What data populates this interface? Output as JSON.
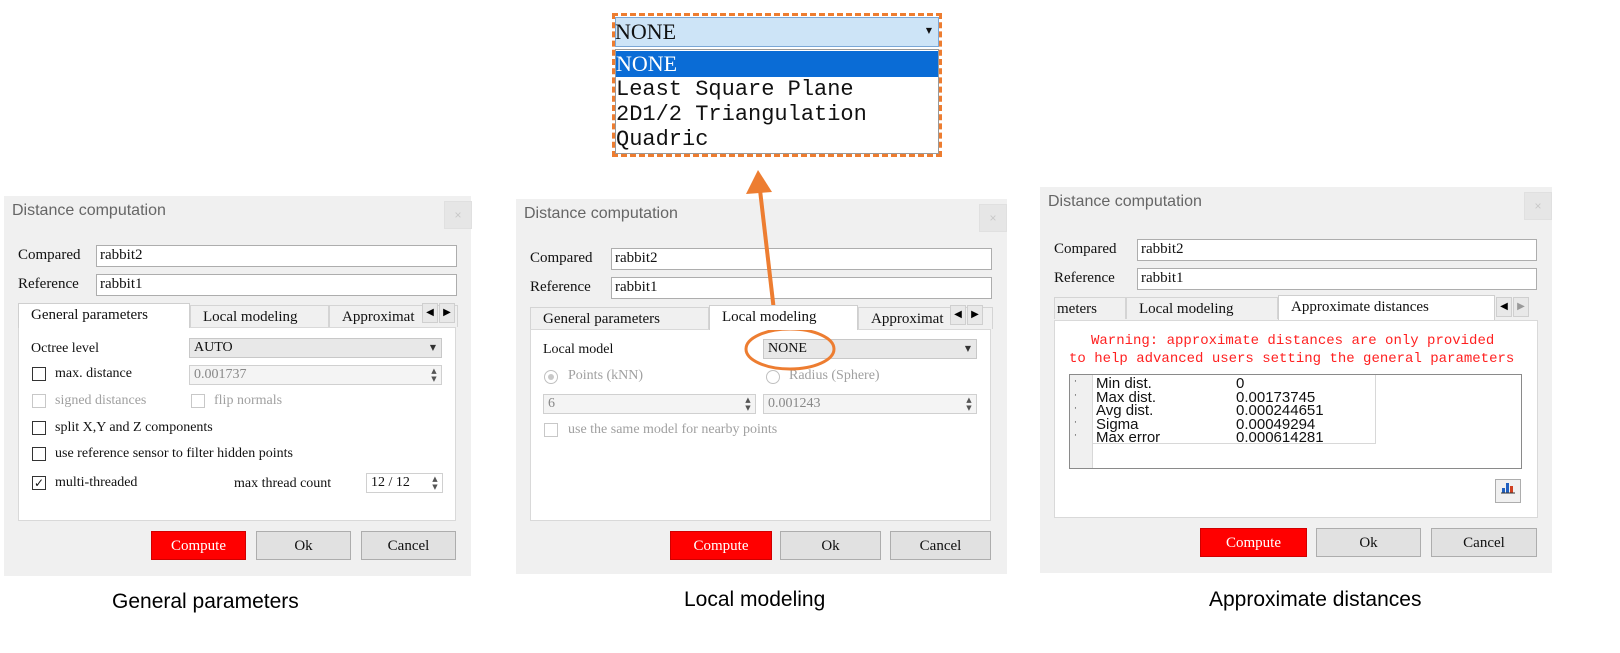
{
  "dialog_title": "Distance computation",
  "close_label": "×",
  "compared_label": "Compared",
  "compared_value": "rabbit2",
  "reference_label": "Reference",
  "reference_value": "rabbit1",
  "tabs": {
    "general": "General parameters",
    "local": "Local modeling",
    "approx_short": "Approximat",
    "approx_full": "Approximate distances",
    "params_cut": "meters"
  },
  "general": {
    "octree_label": "Octree level",
    "octree_value": "AUTO",
    "max_distance_label": "max. distance",
    "max_distance_value": "0.001737",
    "signed_distances_label": "signed distances",
    "flip_normals_label": "flip normals",
    "split_label": "split X,Y and Z components",
    "sensor_label": "use reference sensor to filter hidden points",
    "multithreaded_label": "multi-threaded",
    "multithreaded_checked": true,
    "max_thread_label": "max thread count",
    "max_thread_value": "12 / 12"
  },
  "local": {
    "model_label": "Local model",
    "model_value": "NONE",
    "points_label": "Points (kNN)",
    "radius_label": "Radius (Sphere)",
    "points_value": "6",
    "radius_value": "0.001243",
    "same_model_label": "use the same model for nearby points"
  },
  "approx": {
    "warning_line1": "Warning: approximate distances are only provided",
    "warning_line2": "to help advanced users setting the general parameters",
    "stats": [
      {
        "idx": "·",
        "name": "Min dist.",
        "value": "0"
      },
      {
        "idx": "·",
        "name": "Max dist.",
        "value": "0.00173745"
      },
      {
        "idx": "·",
        "name": "Avg dist.",
        "value": "0.000244651"
      },
      {
        "idx": "·",
        "name": "Sigma",
        "value": "0.00049294"
      },
      {
        "idx": "·",
        "name": "Max error",
        "value": "0.000614281"
      }
    ]
  },
  "buttons": {
    "compute": "Compute",
    "ok": "Ok",
    "cancel": "Cancel"
  },
  "dropdown": {
    "selected": "NONE",
    "options": [
      "NONE",
      "Least Square Plane",
      "2D1/2 Triangulation",
      "Quadric"
    ]
  },
  "captions": {
    "general": "General parameters",
    "local": "Local modeling",
    "approx": "Approximate distances"
  },
  "colors": {
    "highlight_orange": "#ed7d31",
    "compute_red": "#ff0000",
    "selection_blue": "#0a6cd6",
    "warning_red": "#ff2020"
  }
}
